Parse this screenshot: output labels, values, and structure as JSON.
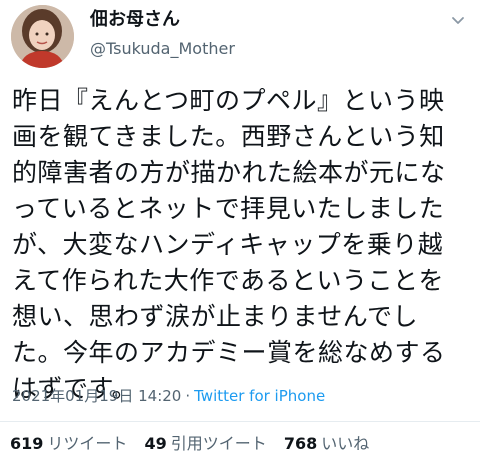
{
  "user": {
    "display_name": "佃お母さん",
    "handle": "@Tsukuda_Mother"
  },
  "tweet": {
    "text": "昨日『えんとつ町のプペル』という映\n画を観てきました。西野さんという知\n的障害者の方が描かれた絵本が元にな\nっているとネットで拝見いたしました\nが、大変なハンディキャップを乗り越\nえて作られた大作であるということを\n想い、思わず涙が止まりませんでし\nた。今年のアカデミー賞を総なめする\nはずです。",
    "timestamp": "2021年01月19日 14:20",
    "dot": "·",
    "source": "Twitter for iPhone"
  },
  "stats": {
    "retweets_count": "619",
    "retweets_label": "リツイート",
    "quotes_count": "49",
    "quotes_label": "引用ツイート",
    "likes_count": "768",
    "likes_label": "いいね"
  },
  "icons": {
    "more": "chevron-down-icon",
    "avatar": "user-avatar"
  },
  "colors": {
    "link": "#1d9bf0",
    "secondary_text": "#536471",
    "primary_text": "#0f1419"
  }
}
